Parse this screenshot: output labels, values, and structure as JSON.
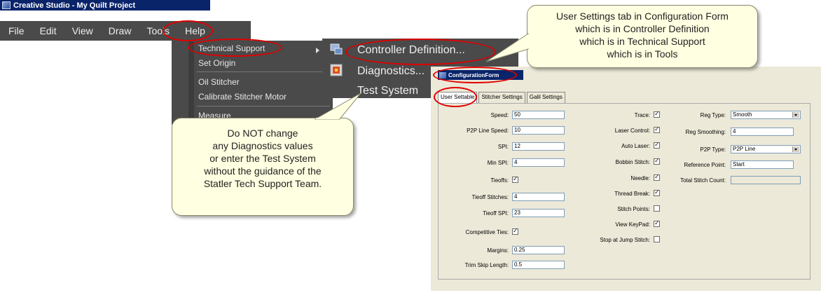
{
  "app": {
    "title": "Creative Studio - My Quilt Project",
    "menu": [
      "File",
      "Edit",
      "View",
      "Draw",
      "Tools",
      "Help"
    ]
  },
  "tools_menu": {
    "items": [
      "Technical Support",
      "Set Origin",
      "Oil Stitcher",
      "Calibrate Stitcher Motor",
      "Measure"
    ]
  },
  "tech_submenu": {
    "items": [
      "Controller Definition...",
      "Diagnostics...",
      "Test System"
    ]
  },
  "config_form": {
    "title": "ConfigurationForm",
    "tabs": [
      "User Settable",
      "Stitcher Settings",
      "Galil Settings"
    ],
    "col1": [
      {
        "label": "Speed:",
        "value": "50"
      },
      {
        "label": "P2P Line Speed:",
        "value": "10"
      },
      {
        "label": "SPI:",
        "value": "12"
      },
      {
        "label": "Min SPI:",
        "value": "4"
      },
      {
        "label": "Tieoffs:",
        "checked": "✓"
      },
      {
        "label": "Tieoff Stitches:",
        "value": "4"
      },
      {
        "label": "Tieoff SPI:",
        "value": "23"
      },
      {
        "label": "Competitive Ties:",
        "checked": "✓"
      },
      {
        "label": "Margins:",
        "value": "0.25"
      },
      {
        "label": "Trim Skip Length:",
        "value": "0.5"
      }
    ],
    "col2": [
      {
        "label": "Trace:",
        "checked": "✓"
      },
      {
        "label": "Laser Control:",
        "checked": "✓"
      },
      {
        "label": "Auto Laser:",
        "checked": "✓"
      },
      {
        "label": "Bobbin Stitch:",
        "checked": "✓"
      },
      {
        "label": "Needle:",
        "checked": "✓"
      },
      {
        "label": "Thread Break:",
        "checked": "✓"
      },
      {
        "label": "Stitch Points:",
        "checked": ""
      },
      {
        "label": "View KeyPad:",
        "checked": "✓"
      },
      {
        "label": "Stop at Jump Stitch:",
        "checked": ""
      }
    ],
    "col3": [
      {
        "label": "Reg Type:",
        "value": "Smooth",
        "dropdown": true
      },
      {
        "label": "Reg Smoothing:",
        "value": "4"
      },
      {
        "label": "P2P Type:",
        "value": "P2P Line",
        "dropdown": true
      },
      {
        "label": "Reference Point:",
        "value": "Start",
        "dropdown": true
      },
      {
        "label": "Total Stitch Count:",
        "value": ""
      }
    ]
  },
  "callouts": {
    "top": [
      "User Settings  tab in Configuration Form",
      "which is in Controller Definition",
      "which is in Technical Support",
      "which is in Tools"
    ],
    "bottom": [
      "Do NOT change",
      "any Diagnostics values",
      "or enter the Test System",
      "without the guidance of the",
      "Statler Tech Support Team."
    ]
  },
  "colors": {
    "highlight": "#e00000",
    "callout_bg": "#ffffe1",
    "menu_bg": "#4a4a4a",
    "titlebar": "#0a246a"
  }
}
